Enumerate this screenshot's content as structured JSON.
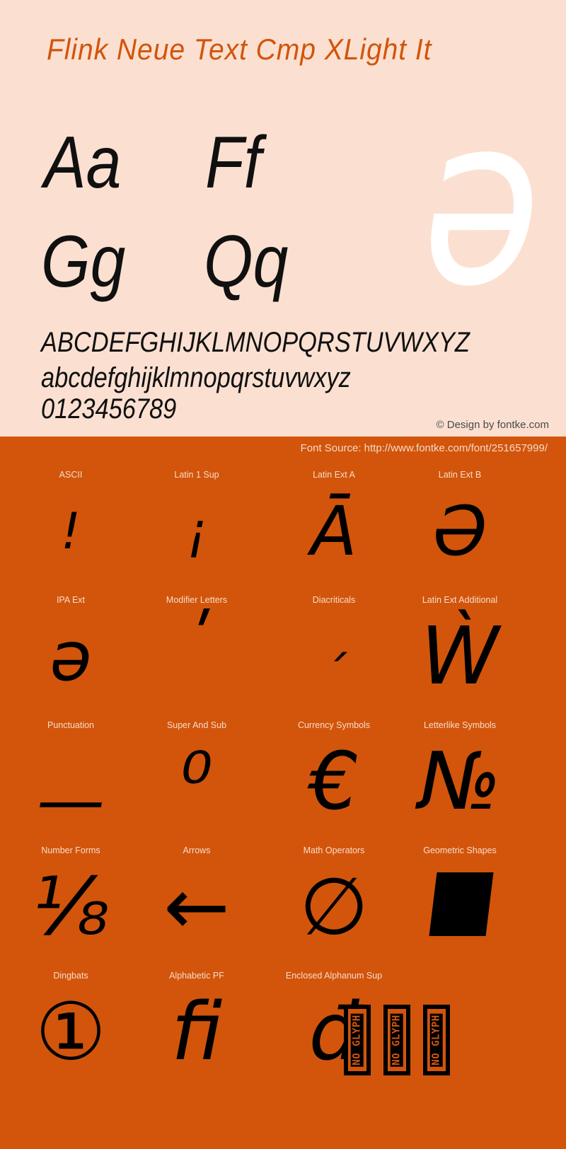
{
  "specimen": {
    "title": "Flink Neue Text Cmp XLight It",
    "hero_glyph": "ǝ",
    "sample_pairs": [
      "Aa",
      "Ff",
      "Gg",
      "Qq"
    ],
    "alphabet_upper": "ABCDEFGHIJKLMNOPQRSTUVWXYZ",
    "alphabet_lower": "abcdefghijklmnopqrstuvwxyz",
    "digits": "0123456789",
    "copyright": "© Design by fontke.com"
  },
  "source_bar": {
    "text": "Font Source: http://www.fontke.com/font/251657999/"
  },
  "glyph_grid": {
    "rows": [
      {
        "cells": [
          {
            "label": "ASCII",
            "glyph": "!",
            "size": "sm"
          },
          {
            "label": "Latin 1 Sup",
            "glyph": "¡",
            "size": "sm"
          },
          {
            "label": "Latin Ext A",
            "glyph": "Ā",
            "size": "md"
          },
          {
            "label": "Latin Ext B",
            "glyph": "Ə",
            "size": "md"
          }
        ]
      },
      {
        "cells": [
          {
            "label": "IPA Ext",
            "glyph": "ə",
            "size": "md"
          },
          {
            "label": "Modifier Letters",
            "glyph": "ʹ",
            "size": "md"
          },
          {
            "label": "Diacriticals",
            "glyph": "ˊ",
            "size": "sm"
          },
          {
            "label": "Latin Ext Additional",
            "glyph": "Ẁ",
            "size": "lg"
          }
        ]
      },
      {
        "cells": [
          {
            "label": "Punctuation",
            "glyph": "—",
            "size": "md"
          },
          {
            "label": "Super And Sub",
            "glyph": "⁰",
            "size": "lg"
          },
          {
            "label": "Currency Symbols",
            "glyph": "€",
            "size": "lg"
          },
          {
            "label": "Letterlike Symbols",
            "glyph": "№",
            "size": "lg"
          }
        ]
      },
      {
        "cells": [
          {
            "label": "Number Forms",
            "glyph": "⅛",
            "size": "lg"
          },
          {
            "label": "Arrows",
            "glyph": "←",
            "size": "lg"
          },
          {
            "label": "Math Operators",
            "glyph": "∅",
            "size": "lg"
          },
          {
            "label": "Geometric Shapes",
            "glyph": "",
            "size": "shape"
          }
        ]
      },
      {
        "cells": [
          {
            "label": "Dingbats",
            "glyph": "①",
            "size": "lg"
          },
          {
            "label": "Alphabetic PF",
            "glyph": "ﬁ",
            "size": "lg"
          },
          {
            "label": "Enclosed Alphanum Sup",
            "glyph": "đ",
            "size": "lg"
          },
          {
            "label": "",
            "glyph": "",
            "size": "noglyph"
          }
        ]
      }
    ],
    "no_glyph_label": "NO GLYPH",
    "no_glyph_count": 3
  },
  "colors": {
    "panel_bg": "#fbe0d1",
    "accent_orange": "#d2550b",
    "title_color": "#d2550b",
    "glyph_black": "#000000",
    "label_cream": "#f7dccb"
  }
}
